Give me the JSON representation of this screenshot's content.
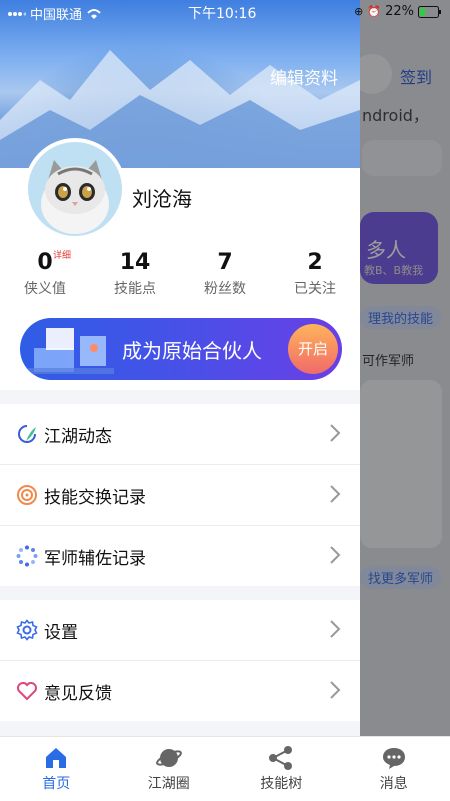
{
  "status_bar": {
    "carrier": "中国联通",
    "time": "下午10:16",
    "battery": "22%"
  },
  "background": {
    "checkin": "签到",
    "fragment_android": "ndroid，",
    "fragment_people": "多人",
    "fragment_teach": "教B、B教我",
    "fragment_manage": "理我的技能",
    "fragment_strategist": "可作军师",
    "fragment_more": "找更多军师"
  },
  "drawer": {
    "edit_profile": "编辑资料",
    "username": "刘沧海",
    "stats": [
      {
        "value": "0",
        "label": "侠义值",
        "badge": "详细"
      },
      {
        "value": "14",
        "label": "技能点"
      },
      {
        "value": "7",
        "label": "粉丝数"
      },
      {
        "value": "2",
        "label": "已关注"
      }
    ],
    "partner_banner": {
      "title": "成为原始合伙人",
      "button": "开启"
    },
    "menu_group_1": [
      "江湖动态",
      "技能交换记录",
      "军师辅佐记录"
    ],
    "menu_group_2": [
      "设置",
      "意见反馈"
    ]
  },
  "tabs": [
    {
      "label": "首页",
      "icon": "home-icon",
      "active": true
    },
    {
      "label": "江湖圈",
      "icon": "planet-icon",
      "active": false
    },
    {
      "label": "技能树",
      "icon": "share-nodes-icon",
      "active": false
    },
    {
      "label": "消息",
      "icon": "chat-bubble-icon",
      "active": false
    }
  ],
  "colors": {
    "accent": "#2a6be6",
    "badge_red": "#e53935",
    "purple": "#6a4ee3"
  }
}
